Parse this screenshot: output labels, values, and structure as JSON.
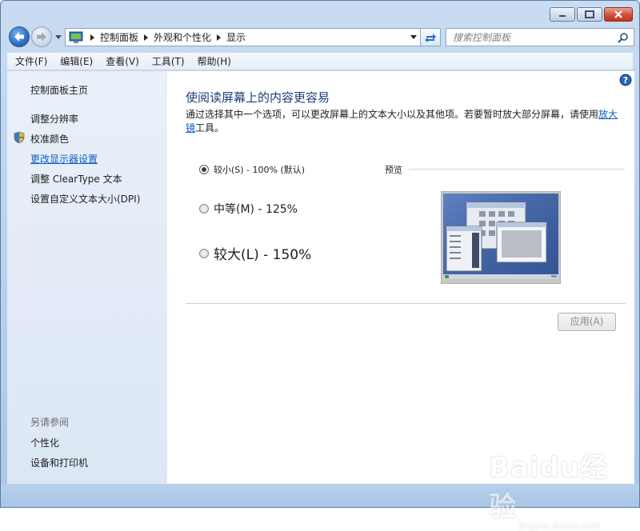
{
  "window": {
    "caption": {
      "minimize": "minimize",
      "maximize": "maximize",
      "close": "close"
    }
  },
  "nav": {
    "breadcrumbs": [
      "控制面板",
      "外观和个性化",
      "显示"
    ],
    "search_placeholder": "搜索控制面板"
  },
  "menu": {
    "items": [
      "文件(F)",
      "编辑(E)",
      "查看(V)",
      "工具(T)",
      "帮助(H)"
    ]
  },
  "sidebar": {
    "home": "控制面板主页",
    "links": [
      "调整分辨率",
      "校准颜色",
      "更改显示器设置",
      "调整 ClearType 文本",
      "设置自定义文本大小(DPI)"
    ],
    "active_index": 2,
    "see_also_title": "另请参阅",
    "see_also": [
      "个性化",
      "设备和打印机"
    ]
  },
  "main": {
    "title": "使阅读屏幕上的内容更容易",
    "description_before": "通过选择其中一个选项，可以更改屏幕上的文本大小以及其他项。若要暂时放大部分屏幕，请使用",
    "description_link": "放大镜",
    "description_after": "工具。",
    "options": [
      {
        "label": "较小(S) - 100% (默认)",
        "checked": true
      },
      {
        "label": "中等(M) - 125%",
        "checked": false
      },
      {
        "label": "较大(L) - 150%",
        "checked": false
      }
    ],
    "preview_label": "预览",
    "apply_label": "应用(A)",
    "apply_enabled": false
  },
  "watermark": {
    "logo": "Baidu经验",
    "sub": "jingyan.baidu.com"
  }
}
